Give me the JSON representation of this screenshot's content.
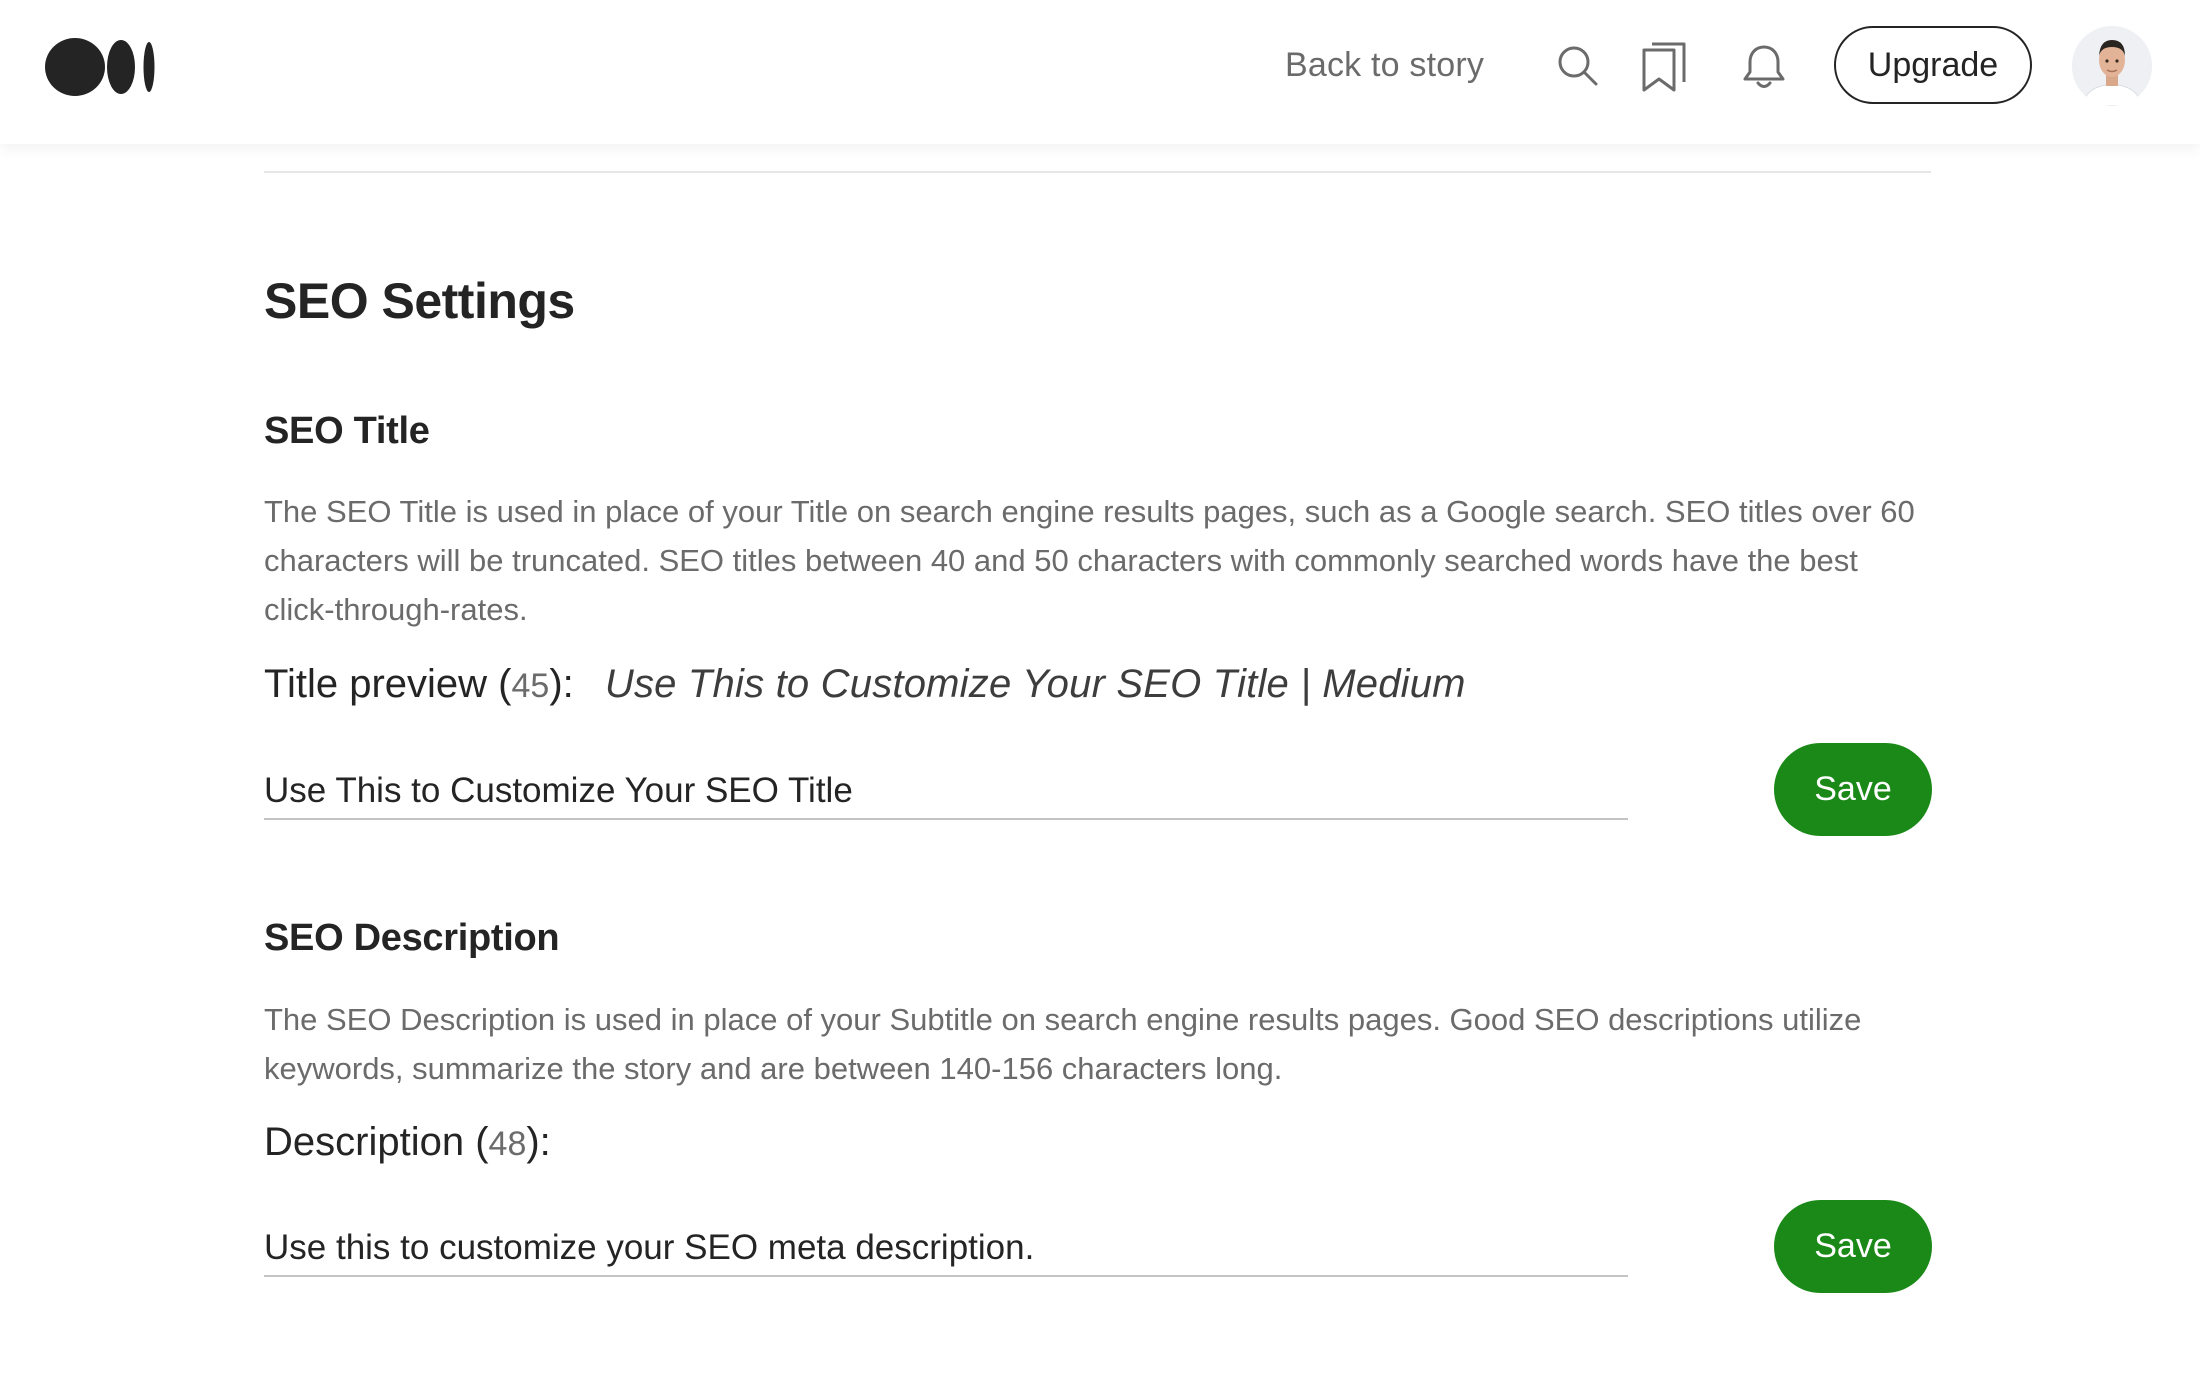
{
  "header": {
    "logo_name": "Medium",
    "back_link": "Back to story",
    "icons": [
      "search-icon",
      "bookmarks-icon",
      "bell-icon"
    ],
    "upgrade_label": "Upgrade"
  },
  "page": {
    "title": "SEO Settings"
  },
  "seo_title": {
    "heading": "SEO Title",
    "description": "The SEO Title is used in place of your Title on search engine results pages, such as a Google search. SEO titles over 60 characters will be truncated. SEO titles between 40 and 50 characters with commonly searched words have the best click-through-rates.",
    "preview_label": "Title preview",
    "count": "45",
    "preview_text": "Use This to Customize Your SEO Title | Medium",
    "input_value": "Use This to Customize Your SEO Title",
    "save_label": "Save"
  },
  "seo_description": {
    "heading": "SEO Description",
    "description": "The SEO Description is used in place of your Subtitle on search engine results pages. Good SEO descriptions utilize keywords, summarize the story and are between 140-156 characters long.",
    "preview_label": "Description",
    "count": "48",
    "input_value": "Use this to customize your SEO meta description.",
    "save_label": "Save"
  },
  "colors": {
    "accent_green": "#1a8917",
    "text_primary": "#242424",
    "text_secondary": "#6b6b6b"
  }
}
